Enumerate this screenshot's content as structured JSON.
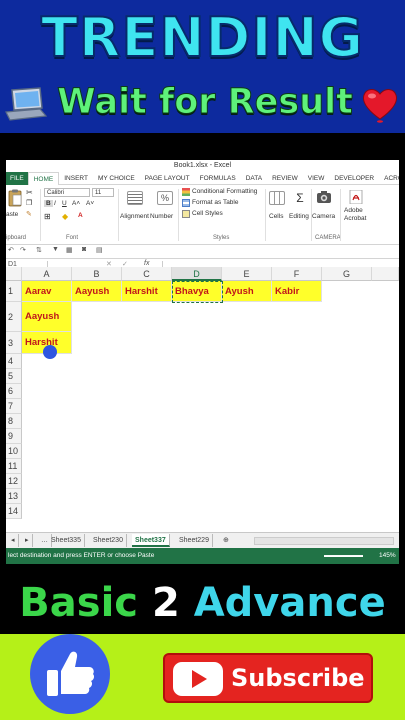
{
  "banner": {
    "title": "TRENDING",
    "subtitle": "Wait for Result"
  },
  "excel": {
    "window_title": "Book1.xlsx - Excel",
    "tabs": [
      "FILE",
      "HOME",
      "INSERT",
      "MY CHOICE",
      "PAGE LAYOUT",
      "FORMULAS",
      "DATA",
      "REVIEW",
      "VIEW",
      "DEVELOPER",
      "ACRO"
    ],
    "active_tab": "HOME",
    "ribbon": {
      "font_name": "Calibri",
      "font_size": "11",
      "paste": "aste",
      "clipboard": "ipboard",
      "font_group": "Font",
      "alignment": "Alignment",
      "number": "Number",
      "conditional_formatting": "Conditional Formatting",
      "format_as_table": "Format as Table",
      "cell_styles": "Cell Styles",
      "styles_group": "Styles",
      "cells": "Cells",
      "editing": "Editing",
      "camera": "Camera",
      "camera_group": "CAMERA",
      "adobe_acrobat": "Adobe Acrobat"
    },
    "name_box": "D1",
    "formula_fx": "fx",
    "columns": [
      "A",
      "B",
      "C",
      "D",
      "E",
      "F",
      "G"
    ],
    "selected_column": "D",
    "rows": [
      "1",
      "2",
      "3",
      "4",
      "5",
      "6",
      "7",
      "8",
      "9",
      "10",
      "11",
      "12",
      "13",
      "14"
    ],
    "cells": {
      "A1": "Aarav",
      "B1": "Aayush",
      "C1": "Harshit",
      "D1": "Bhavya",
      "E1": "Ayush",
      "F1": "Kabir",
      "A2": "Aayush",
      "A3": "Harshit"
    },
    "sheet_tabs": [
      "Sheet335",
      "Sheet230",
      "Sheet337",
      "Sheet229"
    ],
    "active_sheet": "Sheet337",
    "status_text": "lect destination and press ENTER or choose Paste",
    "zoom": "145%"
  },
  "bottom": {
    "basic_word1": "Basic",
    "basic_word2": "2",
    "basic_word3": "Advance",
    "subscribe": "Subscribe"
  },
  "colors": {
    "banner_bg": "#0d2a9e",
    "title": "#3fe4f0",
    "subtitle": "#5ef27a",
    "excel_green": "#217346",
    "cell_highlight": "#ffff2a",
    "cell_text": "#c0161b",
    "lime": "#b5f018",
    "subscribe_red": "#e42420"
  }
}
